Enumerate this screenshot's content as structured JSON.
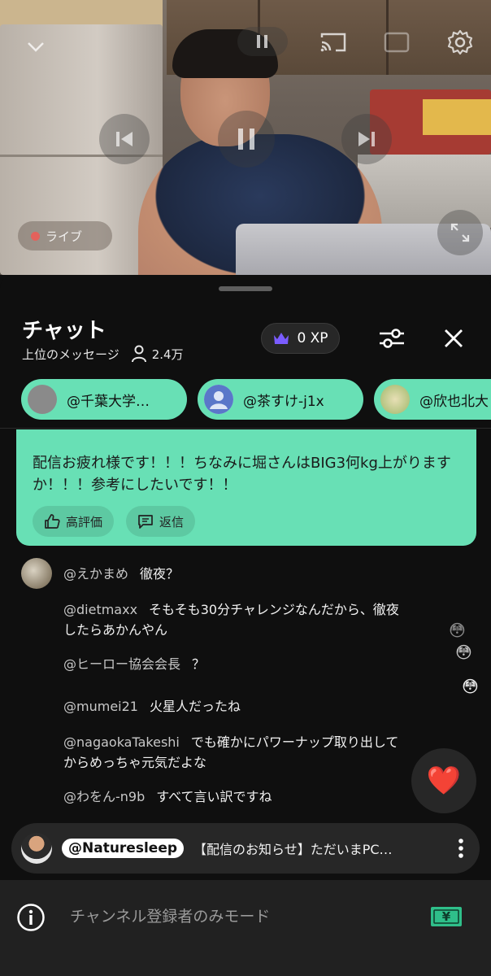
{
  "video": {
    "live_label": "ライブ"
  },
  "chat": {
    "title": "チャット",
    "filter_label": "上位のメッセージ",
    "viewer_count": "2.4万",
    "xp_label": "0 XP"
  },
  "pinned_users": [
    {
      "label": "@千葉大学…",
      "avatar_color": "#8a8a8a"
    },
    {
      "label": "@茶すけ-j1x",
      "avatar_color": "#5a77c9"
    },
    {
      "label": "@欣也北大",
      "avatar_color": "#c9c28a"
    }
  ],
  "highlight": {
    "text": "配信お疲れ様です！！！ちなみに堀さんはBIG3何kg上がりますか！！！参考にしたいです！！",
    "like_label": "高評価",
    "reply_label": "返信"
  },
  "messages": [
    {
      "author": "@えかまめ",
      "text": "徹夜？"
    },
    {
      "author": "@dietmaxx",
      "text": "そもそも30分チャレンジなんだから、徹夜したらあかんやん"
    },
    {
      "author": "@ヒーロー協会会長",
      "text": "？"
    },
    {
      "author": "@mumei21",
      "text": "火星人だったね"
    },
    {
      "author": "@nagaokaTakeshi",
      "text": "でも確かにパワーナップ取り出してからめっちゃ元気だよな"
    },
    {
      "author": "@わをん-n9b",
      "text": "すべて言い訳ですね"
    }
  ],
  "floating_emojis": [
    "😳",
    "😳",
    "😳"
  ],
  "reaction_emoji": "❤️",
  "ticker": {
    "handle": "@Naturesleep",
    "text": "【配信のお知らせ】ただいまPC…"
  },
  "bottom": {
    "mode_text": "チャンネル登録者のみモード"
  },
  "colors": {
    "accent_green": "#68e0b5",
    "live_red": "#e4625c",
    "crown_purple": "#7a5cff",
    "money_green": "#2fbf8a"
  }
}
